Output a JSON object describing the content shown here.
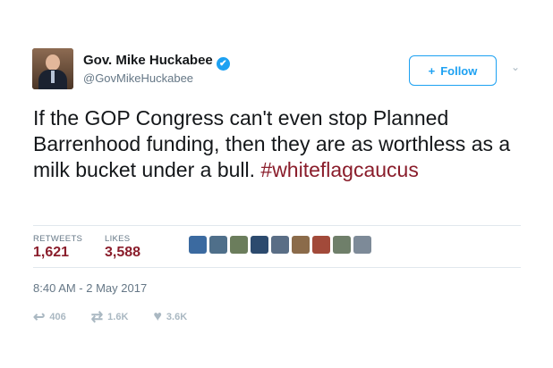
{
  "author": {
    "name": "Gov. Mike Huckabee",
    "handle": "@GovMikeHuckabee",
    "verified_icon": "✔"
  },
  "follow": {
    "label": "Follow",
    "icon": "+"
  },
  "menu": {
    "chevron": "⌄"
  },
  "tweet": {
    "text": "If the GOP Congress can't even stop Planned Barrenhood funding, then they are as worthless as a milk bucket under a bull.",
    "hashtag": "#whiteflagcaucus"
  },
  "stats": {
    "retweets_label": "RETWEETS",
    "retweets_value": "1,621",
    "likes_label": "LIKES",
    "likes_value": "3,588"
  },
  "liker_colors": [
    "#3b6aa0",
    "#4f6f8a",
    "#6b7d5c",
    "#2c4a6e",
    "#5a6e86",
    "#8b6b4a",
    "#a24a3a",
    "#6f7f6a",
    "#7d8a98"
  ],
  "timestamp": "8:40 AM - 2 May 2017",
  "actions": {
    "reply_count": "406",
    "retweet_count": "1.6K",
    "like_count": "3.6K"
  },
  "colors": {
    "accent": "#1da1f2",
    "link": "#8a1d2b",
    "muted": "#657786"
  }
}
